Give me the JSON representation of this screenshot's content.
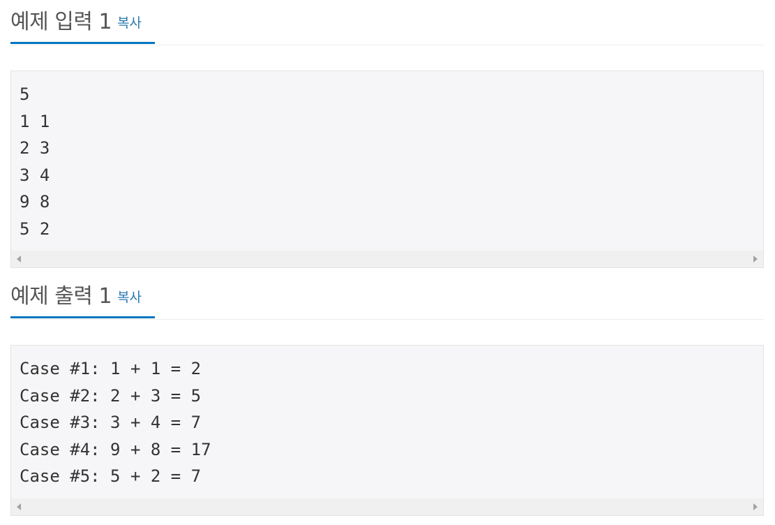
{
  "input_section": {
    "title": "예제 입력 1",
    "copy_label": "복사",
    "lines": [
      "5",
      "1 1",
      "2 3",
      "3 4",
      "9 8",
      "5 2"
    ]
  },
  "output_section": {
    "title": "예제 출력 1",
    "copy_label": "복사",
    "lines": [
      "Case #1: 1 + 1 = 2",
      "Case #2: 2 + 3 = 5",
      "Case #3: 3 + 4 = 7",
      "Case #4: 9 + 8 = 17",
      "Case #5: 5 + 2 = 7"
    ]
  },
  "colors": {
    "accent": "#0076c0",
    "link": "#2a7ab0",
    "sample_bg": "#f6f6f8",
    "title_text": "#555555"
  }
}
